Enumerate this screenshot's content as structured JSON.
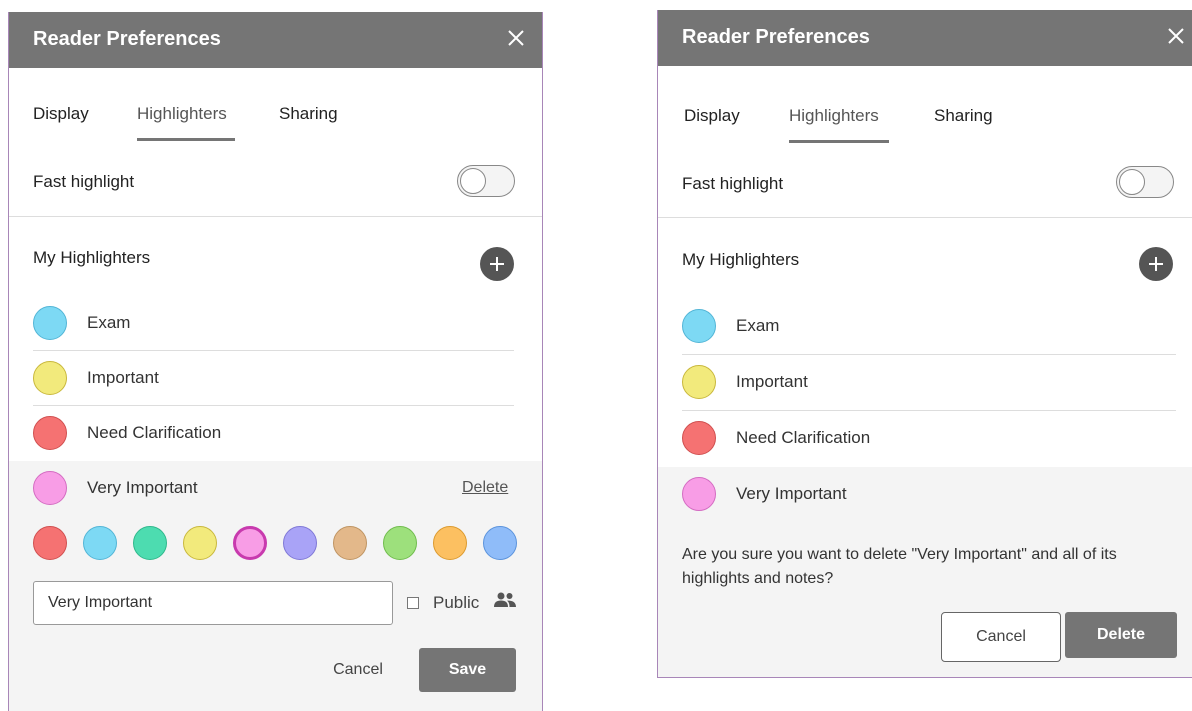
{
  "left": {
    "title": "Reader Preferences",
    "tabs": [
      {
        "label": "Display",
        "active": false
      },
      {
        "label": "Highlighters",
        "active": true
      },
      {
        "label": "Sharing",
        "active": false
      }
    ],
    "fast_highlight": {
      "label": "Fast highlight",
      "enabled": false
    },
    "my_highlighters_label": "My Highlighters",
    "highlighters": [
      {
        "label": "Exam",
        "color": "#7dd9f4"
      },
      {
        "label": "Important",
        "color": "#f2ea7c"
      },
      {
        "label": "Need Clarification",
        "color": "#f57272"
      },
      {
        "label": "Very Important",
        "color": "#f89de6"
      }
    ],
    "delete_label": "Delete",
    "palette": [
      "#f57272",
      "#7dd9f4",
      "#4ddcb0",
      "#f2ea7c",
      "#f89de6",
      "#a9a3f7",
      "#e3b88a",
      "#9de07c",
      "#fcc061",
      "#8fbcf9"
    ],
    "selected_color": "#f89de6",
    "name_input_value": "Very Important",
    "public_label": "Public",
    "public_checked": false,
    "cancel_label": "Cancel",
    "save_label": "Save"
  },
  "right": {
    "title": "Reader Preferences",
    "tabs": [
      {
        "label": "Display",
        "active": false
      },
      {
        "label": "Highlighters",
        "active": true
      },
      {
        "label": "Sharing",
        "active": false
      }
    ],
    "fast_highlight": {
      "label": "Fast highlight",
      "enabled": false
    },
    "my_highlighters_label": "My Highlighters",
    "highlighters": [
      {
        "label": "Exam",
        "color": "#7dd9f4"
      },
      {
        "label": "Important",
        "color": "#f2ea7c"
      },
      {
        "label": "Need Clarification",
        "color": "#f57272"
      },
      {
        "label": "Very Important",
        "color": "#f89de6"
      }
    ],
    "confirm_text": "Are you sure you want to delete \"Very Important\" and all of its highlights and notes?",
    "cancel_label": "Cancel",
    "delete_label": "Delete"
  },
  "colors": {
    "header_bg": "#757575",
    "panel_border": "#a886b8",
    "gray_area": "#f4f4f4",
    "primary_button": "#757575"
  }
}
